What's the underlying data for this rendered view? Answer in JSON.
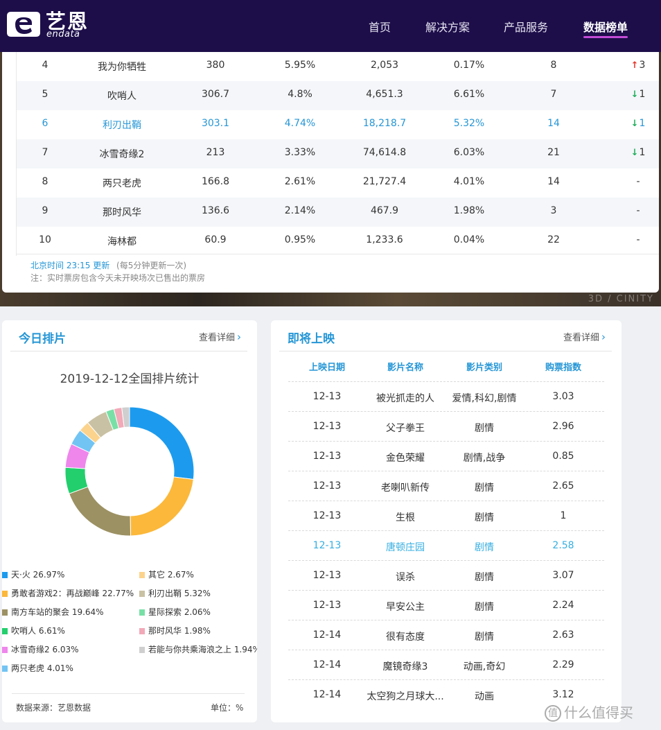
{
  "header": {
    "logo_cn": "艺恩",
    "logo_en": "endata",
    "nav": [
      "首页",
      "解决方案",
      "产品服务",
      "数据榜单"
    ]
  },
  "rank_table": {
    "rows": [
      {
        "rank": "4",
        "name": "我为你牺牲",
        "box": "380",
        "share": "5.95%",
        "total": "2,053",
        "rate": "0.17%",
        "days": "8",
        "trend": "3",
        "dir": "up"
      },
      {
        "rank": "5",
        "name": "吹哨人",
        "box": "306.7",
        "share": "4.8%",
        "total": "4,651.3",
        "rate": "6.61%",
        "days": "7",
        "trend": "1",
        "dir": "down"
      },
      {
        "rank": "6",
        "name": "利刃出鞘",
        "box": "303.1",
        "share": "4.74%",
        "total": "18,218.7",
        "rate": "5.32%",
        "days": "14",
        "trend": "1",
        "dir": "down"
      },
      {
        "rank": "7",
        "name": "冰雪奇缘2",
        "box": "213",
        "share": "3.33%",
        "total": "74,614.8",
        "rate": "6.03%",
        "days": "21",
        "trend": "1",
        "dir": "down"
      },
      {
        "rank": "8",
        "name": "两只老虎",
        "box": "166.8",
        "share": "2.61%",
        "total": "21,727.4",
        "rate": "4.01%",
        "days": "14",
        "trend": "-",
        "dir": "none"
      },
      {
        "rank": "9",
        "name": "那时风华",
        "box": "136.6",
        "share": "2.14%",
        "total": "467.9",
        "rate": "1.98%",
        "days": "3",
        "trend": "-",
        "dir": "none"
      },
      {
        "rank": "10",
        "name": "海林都",
        "box": "60.9",
        "share": "0.95%",
        "total": "1,233.6",
        "rate": "0.04%",
        "days": "22",
        "trend": "-",
        "dir": "none"
      }
    ],
    "update_time": "北京时间 23:15 更新",
    "update_note": "(每5分钟更新一次)",
    "footnote": "注：实时票房包含今天未开映场次已售出的票房"
  },
  "bg_text": "3D / CINITY",
  "schedule_card": {
    "title": "今日排片",
    "more": "查看详细",
    "source": "数据来源：艺恩数据",
    "unit": "单位：%"
  },
  "chart_data": {
    "type": "pie",
    "title": "2019-12-12全国排片统计",
    "slices": [
      {
        "name": "天·火",
        "value": 26.97,
        "color": "#1c9bee"
      },
      {
        "name": "勇敢者游戏2：再战巅峰",
        "value": 22.77,
        "color": "#fbb83a"
      },
      {
        "name": "南方车站的聚会",
        "value": 19.64,
        "color": "#9c9163"
      },
      {
        "name": "吹哨人",
        "value": 6.61,
        "color": "#22cf6c"
      },
      {
        "name": "冰雪奇缘2",
        "value": 6.03,
        "color": "#ee86ec"
      },
      {
        "name": "两只老虎",
        "value": 4.01,
        "color": "#72c4f3"
      },
      {
        "name": "其它",
        "value": 2.67,
        "color": "#fcd38c"
      },
      {
        "name": "利刃出鞘",
        "value": 5.32,
        "color": "#c9c1a3"
      },
      {
        "name": "星际探索",
        "value": 2.06,
        "color": "#78e0a6"
      },
      {
        "name": "那时风华",
        "value": 1.98,
        "color": "#f2a9b8"
      },
      {
        "name": "若能与你共乘海浪之上",
        "value": 1.94,
        "color": "#cfcfcf"
      }
    ],
    "legend_labels": [
      "天·火 26.97%",
      "勇敢者游戏2：再战巅峰 22.77%",
      "南方车站的聚会 19.64%",
      "吹哨人 6.61%",
      "冰雪奇缘2 6.03%",
      "两只老虎 4.01%",
      "其它 2.67%",
      "利刃出鞘 5.32%",
      "星际探索 2.06%",
      "那时风华 1.98%",
      "若能与你共乘海浪之上 1.94%"
    ]
  },
  "upcoming_card": {
    "title": "即将上映",
    "more": "查看详细",
    "columns": [
      "上映日期",
      "影片名称",
      "影片类别",
      "购票指数"
    ],
    "rows": [
      {
        "date": "12-13",
        "name": "被光抓走的人",
        "genre": "爱情,科幻,剧情",
        "index": "3.03"
      },
      {
        "date": "12-13",
        "name": "父子拳王",
        "genre": "剧情",
        "index": "2.96"
      },
      {
        "date": "12-13",
        "name": "金色荣耀",
        "genre": "剧情,战争",
        "index": "0.85"
      },
      {
        "date": "12-13",
        "name": "老喇叭新传",
        "genre": "剧情",
        "index": "2.65"
      },
      {
        "date": "12-13",
        "name": "生根",
        "genre": "剧情",
        "index": "1"
      },
      {
        "date": "12-13",
        "name": "唐顿庄园",
        "genre": "剧情",
        "index": "2.58"
      },
      {
        "date": "12-13",
        "name": "误杀",
        "genre": "剧情",
        "index": "3.07"
      },
      {
        "date": "12-13",
        "name": "早安公主",
        "genre": "剧情",
        "index": "2.24"
      },
      {
        "date": "12-14",
        "name": "很有态度",
        "genre": "剧情",
        "index": "2.63"
      },
      {
        "date": "12-14",
        "name": "魔镜奇缘3",
        "genre": "动画,奇幻",
        "index": "2.29"
      },
      {
        "date": "12-14",
        "name": "太空狗之月球大...",
        "genre": "动画",
        "index": "3.12"
      }
    ]
  },
  "watermark": "什么值得买",
  "colors": {
    "header": "#1d0e4a",
    "accent": "#2596d6",
    "nav_underline": "#c24bd6",
    "up": "#e4372c",
    "down": "#1fae5b"
  }
}
